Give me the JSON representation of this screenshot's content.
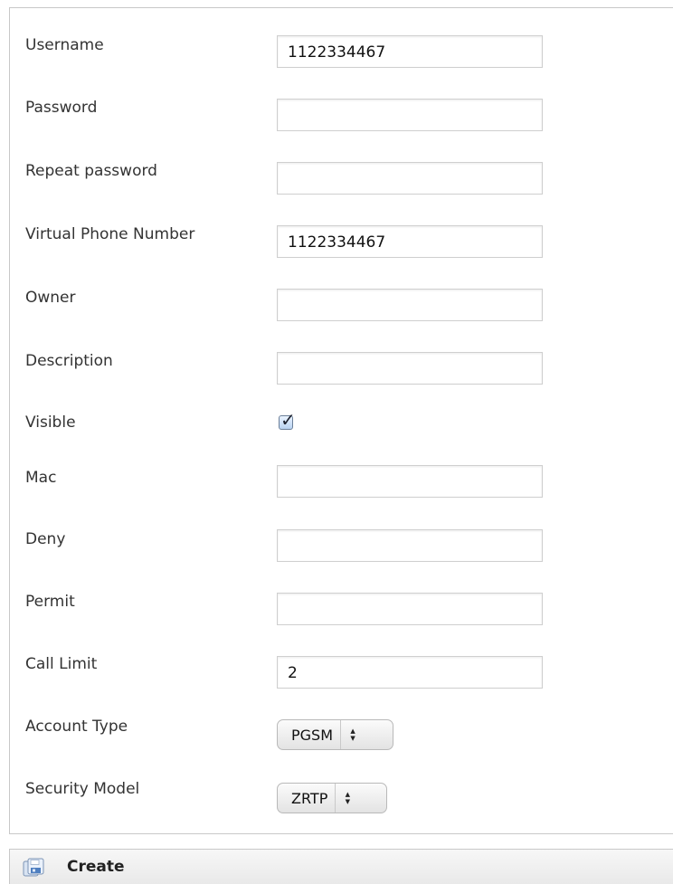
{
  "form": {
    "fields": {
      "username": {
        "label": "Username",
        "value": "1122334467"
      },
      "password": {
        "label": "Password",
        "value": ""
      },
      "repeat_password": {
        "label": "Repeat password",
        "value": ""
      },
      "virtual_phone_number": {
        "label": "Virtual Phone Number",
        "value": "1122334467"
      },
      "owner": {
        "label": "Owner",
        "value": ""
      },
      "description": {
        "label": "Description",
        "value": ""
      },
      "visible": {
        "label": "Visible",
        "checked": true
      },
      "mac": {
        "label": "Mac",
        "value": ""
      },
      "deny": {
        "label": "Deny",
        "value": ""
      },
      "permit": {
        "label": "Permit",
        "value": ""
      },
      "call_limit": {
        "label": "Call Limit",
        "value": "2"
      },
      "account_type": {
        "label": "Account Type",
        "selected": "PGSM"
      },
      "security_model": {
        "label": "Security Model",
        "selected": "ZRTP"
      }
    }
  },
  "actions": {
    "create_label": "Create",
    "create_icon": "save-icon"
  }
}
